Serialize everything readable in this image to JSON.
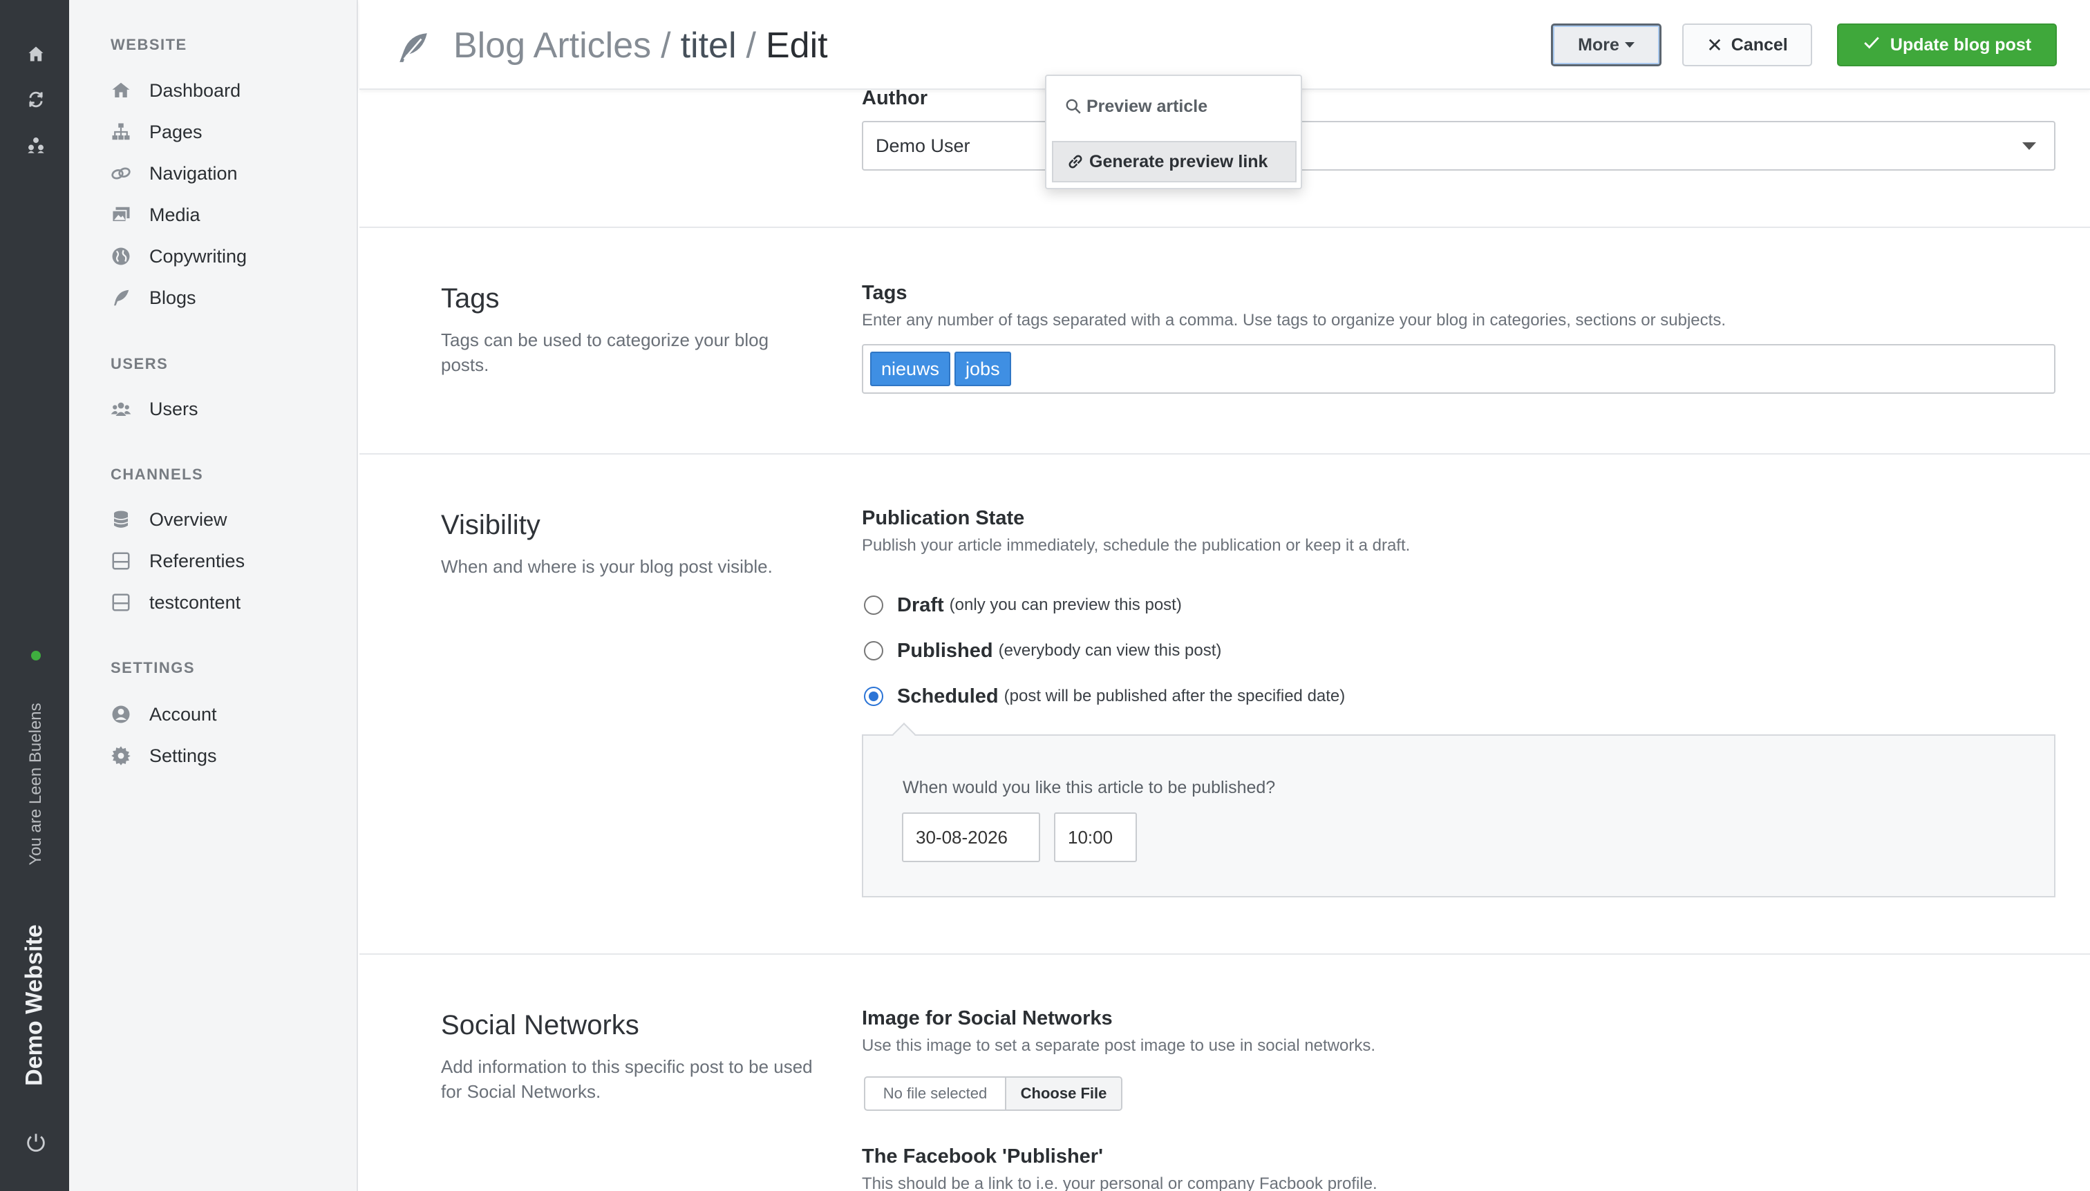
{
  "rail": {
    "user_label": "You are Leen Buelens",
    "site_name": "Demo Website",
    "icons": [
      "home-icon",
      "refresh-icon",
      "users-switch-icon",
      "power-icon"
    ],
    "status_color": "#3fae3f"
  },
  "sidebar": {
    "sections": [
      {
        "title": "WEBSITE",
        "items": [
          {
            "label": "Dashboard",
            "icon": "home-icon"
          },
          {
            "label": "Pages",
            "icon": "sitemap-icon"
          },
          {
            "label": "Navigation",
            "icon": "link-icon"
          },
          {
            "label": "Media",
            "icon": "images-icon"
          },
          {
            "label": "Copywriting",
            "icon": "globe-icon"
          },
          {
            "label": "Blogs",
            "icon": "feather-icon"
          }
        ]
      },
      {
        "title": "USERS",
        "items": [
          {
            "label": "Users",
            "icon": "users-icon"
          }
        ]
      },
      {
        "title": "CHANNELS",
        "items": [
          {
            "label": "Overview",
            "icon": "database-icon"
          },
          {
            "label": "Referenties",
            "icon": "channel-icon"
          },
          {
            "label": "testcontent",
            "icon": "channel-icon"
          }
        ]
      },
      {
        "title": "SETTINGS",
        "items": [
          {
            "label": "Account",
            "icon": "user-circle-icon"
          },
          {
            "label": "Settings",
            "icon": "gear-icon"
          }
        ]
      }
    ]
  },
  "header": {
    "breadcrumb": [
      "Blog Articles",
      "titel",
      "Edit"
    ],
    "separator": "/",
    "buttons": {
      "more": "More",
      "cancel": "Cancel",
      "update": "Update blog post"
    },
    "accent_color": "#3fa83b"
  },
  "more_menu": {
    "items": [
      "Preview article",
      "Generate preview link"
    ],
    "active_item": "Generate preview link"
  },
  "author": {
    "label": "Author",
    "value": "Demo User"
  },
  "tags": {
    "title": "Tags",
    "description": "Tags can be used to categorize your blog posts.",
    "label": "Tags",
    "help": "Enter any number of tags separated with a comma. Use tags to organize your blog in categories, sections or subjects.",
    "values": [
      "nieuws",
      "jobs"
    ],
    "tag_color": "#3f8fe3"
  },
  "visibility": {
    "title": "Visibility",
    "description": "When and where is your blog post visible.",
    "label": "Publication State",
    "help": "Publish your article immediately, schedule the publication or keep it a draft.",
    "options": [
      {
        "label": "Draft",
        "note": "(only you can preview this post)",
        "checked": false
      },
      {
        "label": "Published",
        "note": "(everybody can view this post)",
        "checked": false
      },
      {
        "label": "Scheduled",
        "note": "(post will be published after the specified date)",
        "checked": true
      }
    ],
    "schedule_question": "When would you like this article to be published?",
    "date": "30-08-2026",
    "time": "10:00"
  },
  "social": {
    "title": "Social Networks",
    "description": "Add information to this specific post to be used for Social Networks.",
    "image_label": "Image for Social Networks",
    "image_help": "Use this image to set a separate post image to use in social networks.",
    "file_status": "No file selected",
    "file_button": "Choose File",
    "publisher_label": "The Facebook 'Publisher'",
    "publisher_help": "This should be a link to i.e. your personal or company Facbook profile."
  }
}
